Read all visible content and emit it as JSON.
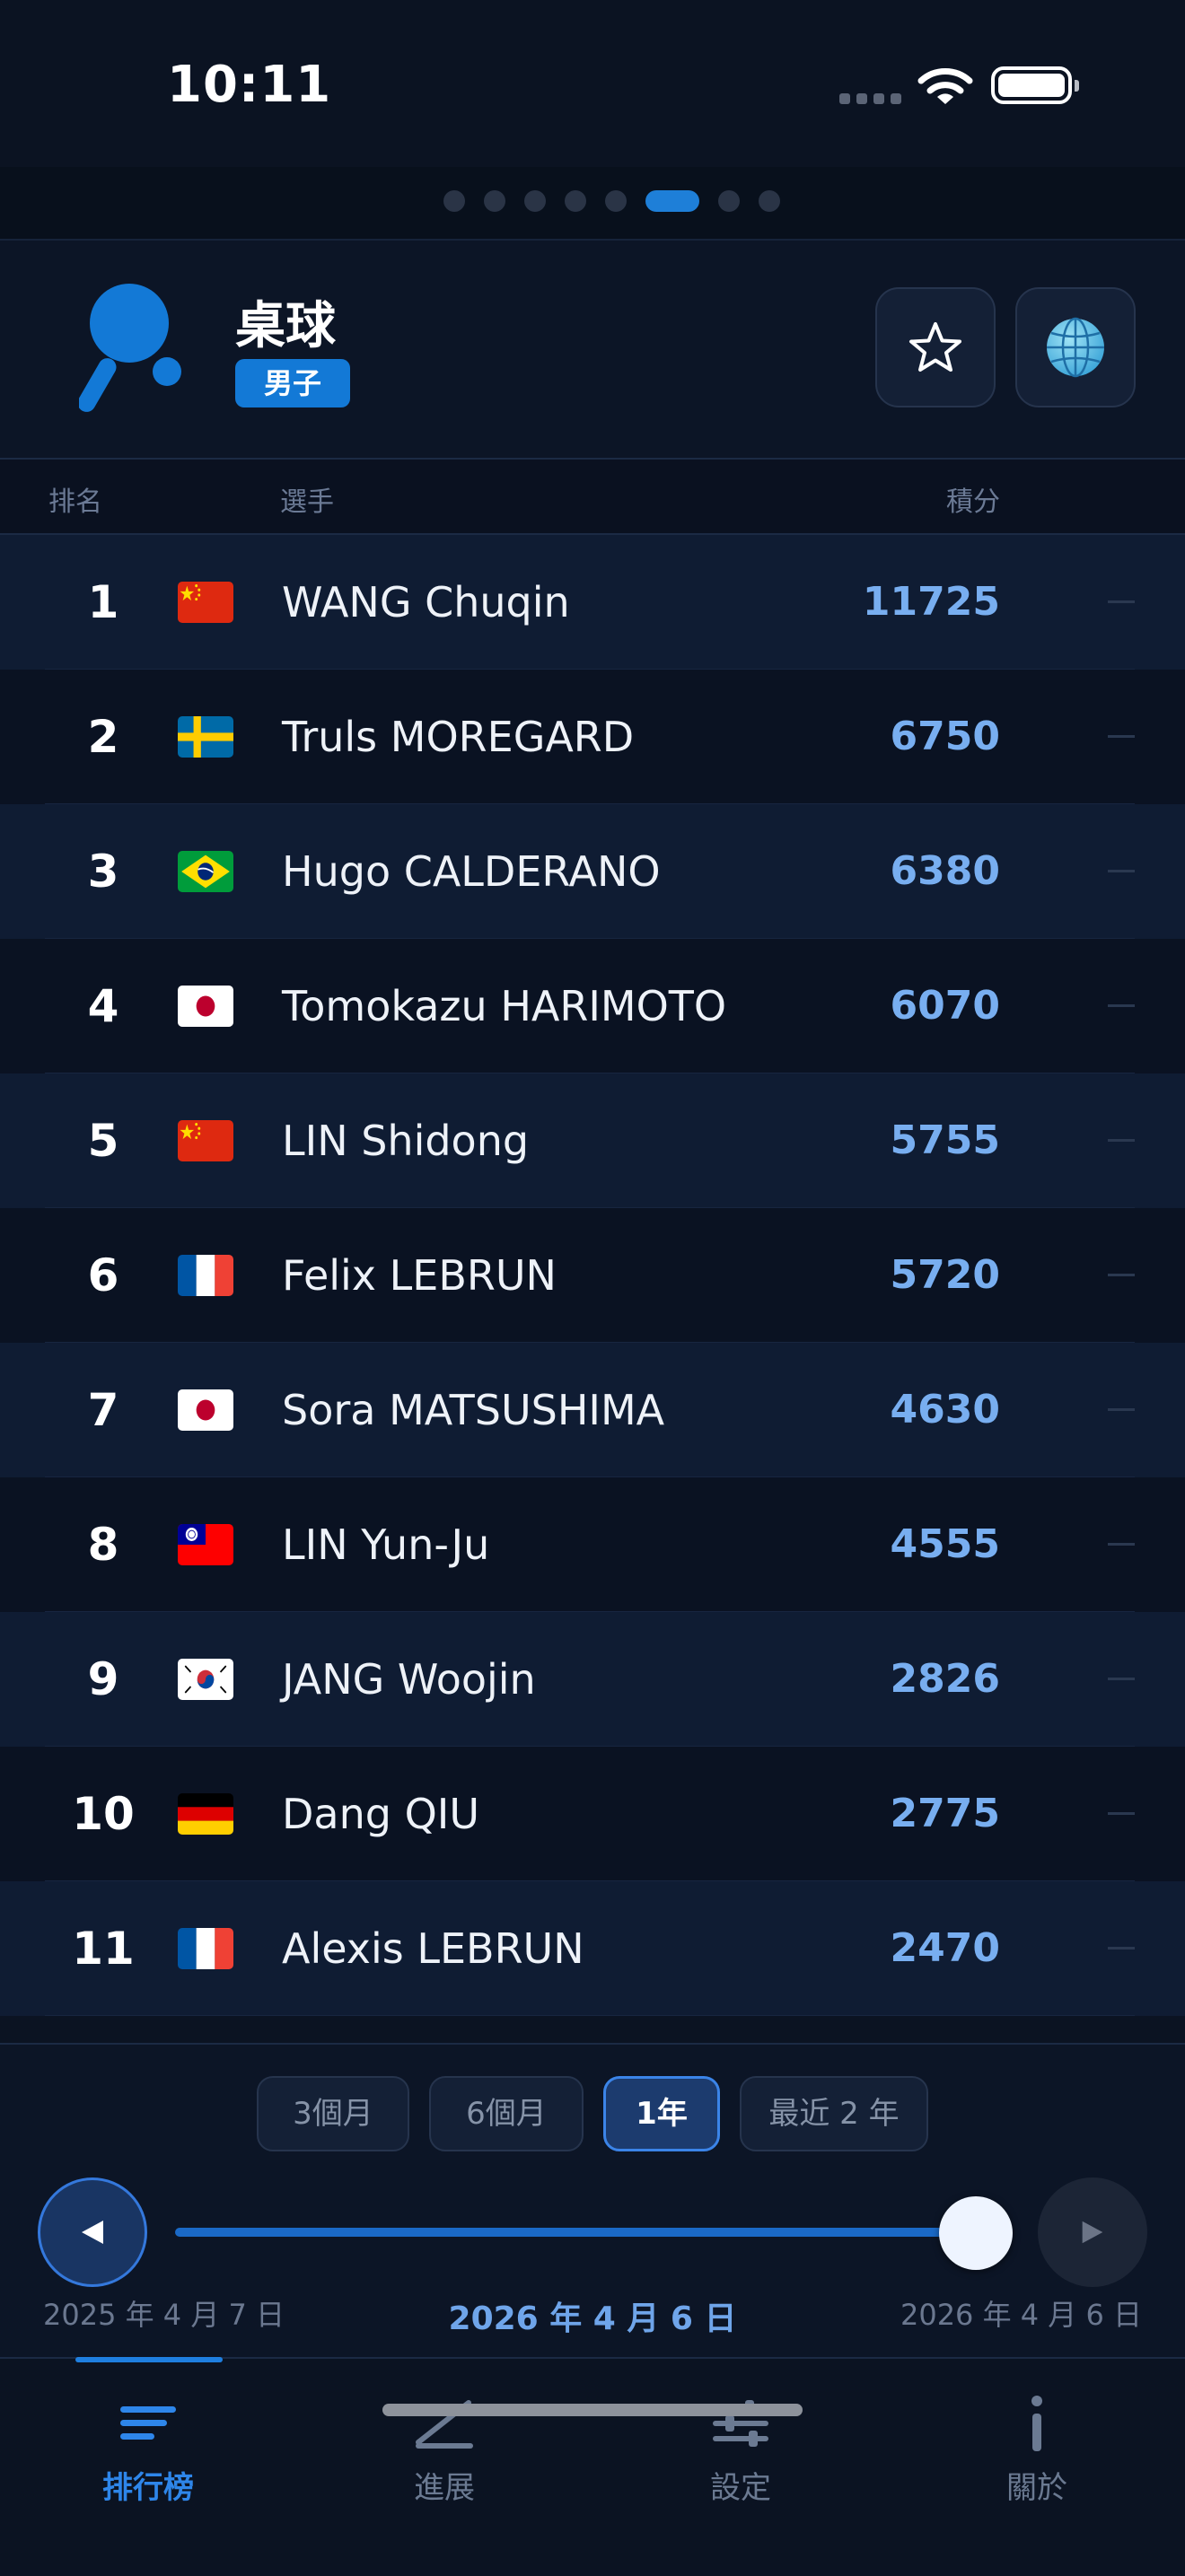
{
  "status": {
    "time": "10:11"
  },
  "pager": {
    "total": 8,
    "active_index": 5
  },
  "header": {
    "sport": "桌球",
    "gender": "男子",
    "logo_icon": "table-tennis-paddle-icon",
    "favorite_icon": "star-icon",
    "globe_icon": "globe-icon"
  },
  "columns": {
    "rank": "排名",
    "player": "選手",
    "points": "積分"
  },
  "rankings": [
    {
      "rank": "1",
      "flag": "cn",
      "name": "WANG Chuqin",
      "points": "11725",
      "trend": "—"
    },
    {
      "rank": "2",
      "flag": "se",
      "name": "Truls MOREGARD",
      "points": "6750",
      "trend": "—"
    },
    {
      "rank": "3",
      "flag": "br",
      "name": "Hugo CALDERANO",
      "points": "6380",
      "trend": "—"
    },
    {
      "rank": "4",
      "flag": "jp",
      "name": "Tomokazu HARIMOTO",
      "points": "6070",
      "trend": "—"
    },
    {
      "rank": "5",
      "flag": "cn",
      "name": "LIN Shidong",
      "points": "5755",
      "trend": "—"
    },
    {
      "rank": "6",
      "flag": "fr",
      "name": "Felix LEBRUN",
      "points": "5720",
      "trend": "—"
    },
    {
      "rank": "7",
      "flag": "jp",
      "name": "Sora MATSUSHIMA",
      "points": "4630",
      "trend": "—"
    },
    {
      "rank": "8",
      "flag": "tw",
      "name": "LIN Yun-Ju",
      "points": "4555",
      "trend": "—"
    },
    {
      "rank": "9",
      "flag": "kr",
      "name": "JANG Woojin",
      "points": "2826",
      "trend": "—"
    },
    {
      "rank": "10",
      "flag": "de",
      "name": "Dang QIU",
      "points": "2775",
      "trend": "—"
    },
    {
      "rank": "11",
      "flag": "fr",
      "name": "Alexis LEBRUN",
      "points": "2470",
      "trend": "—"
    }
  ],
  "period": {
    "options": [
      "3個月",
      "6個月",
      "1年",
      "最近 2 年"
    ],
    "selected": "1年",
    "start_date": "2025 年 4 月 7 日",
    "current_date": "2026 年 4 月 6 日",
    "end_date": "2026 年 4 月 6 日",
    "slider_value": 1.0
  },
  "tabs": [
    {
      "label": "排行榜",
      "icon": "list-icon",
      "active": true
    },
    {
      "label": "進展",
      "icon": "trend-line-icon",
      "active": false
    },
    {
      "label": "設定",
      "icon": "sliders-icon",
      "active": false
    },
    {
      "label": "關於",
      "icon": "info-icon",
      "active": false
    }
  ],
  "colors": {
    "accent": "#1e7fd8",
    "points": "#78aef0",
    "background": "#0b1322"
  }
}
